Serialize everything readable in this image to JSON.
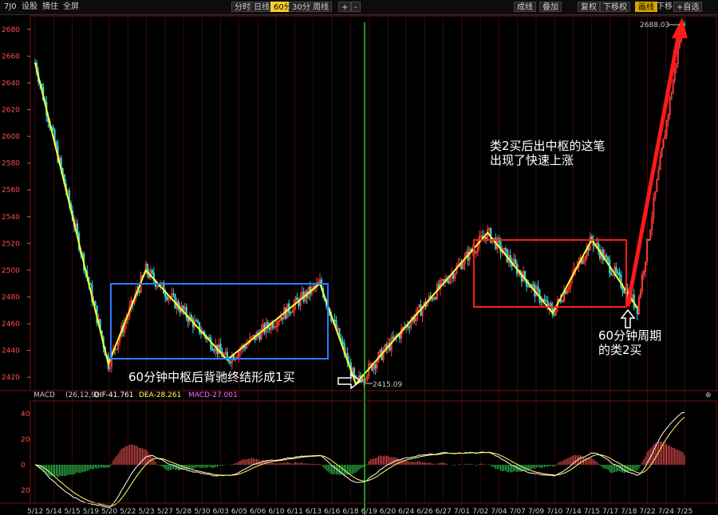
{
  "toolbar": {
    "left": {
      "code": "7J0",
      "item1": "设股",
      "item2": "摘住",
      "item3": "全屏"
    },
    "periods": {
      "p1": "分时",
      "p2": "日线",
      "p3": "60分",
      "p4": "30分",
      "p5": "周线",
      "plus": "+",
      "minus": "-"
    },
    "right": {
      "r1": "成线",
      "r2": "叠加",
      "r3": "复权",
      "r4": "下移权",
      "r5": "画线",
      "r6": "下移",
      "r7": "自选"
    }
  },
  "colors": {
    "background": "#000000",
    "up_candle": "#ff3b3b",
    "down_candle": "#33d6d6",
    "stroke_line": "#ffff33",
    "blue_box": "#2a7bff",
    "red_box": "#ff1a1a",
    "green_line": "#33ff33",
    "dif": "#ffffff",
    "dea": "#ffff66"
  },
  "chart_data": [
    {
      "type": "candlestick",
      "ylim": [
        2410,
        2690
      ],
      "y_ticks": [
        2420,
        2440,
        2460,
        2480,
        2500,
        2520,
        2540,
        2560,
        2580,
        2600,
        2620,
        2640,
        2660,
        2680
      ],
      "x_labels": [
        "5/12",
        "5/14",
        "5/15",
        "5/19",
        "5/20",
        "5/22",
        "5/23",
        "5/27",
        "5/28",
        "5/30",
        "6/03",
        "6/05",
        "6/06",
        "6/10",
        "6/11",
        "6/13",
        "6/16",
        "6/18",
        "6/19",
        "6/20",
        "6/24",
        "6/26",
        "6/27",
        "7/01",
        "7/02",
        "7/04",
        "7/07",
        "7/09",
        "7/10",
        "7/14",
        "7/15",
        "7/17",
        "7/18",
        "7/22",
        "7/24",
        "7/25"
      ],
      "max_label": "2688.03",
      "min_label": "2415.09",
      "stroke_points": [
        {
          "bar": 0,
          "price": 2655
        },
        {
          "bar": 45,
          "price": 2430
        },
        {
          "bar": 68,
          "price": 2500
        },
        {
          "bar": 118,
          "price": 2433
        },
        {
          "bar": 175,
          "price": 2490
        },
        {
          "bar": 197,
          "price": 2415
        },
        {
          "bar": 278,
          "price": 2528
        },
        {
          "bar": 318,
          "price": 2468
        },
        {
          "bar": 342,
          "price": 2523
        },
        {
          "bar": 370,
          "price": 2472
        }
      ],
      "rally": {
        "from": {
          "bar": 370,
          "price": 2472
        },
        "to": {
          "bar": 398,
          "price": 2688
        }
      },
      "annotations": [
        {
          "text_lines": [
            "类2买后出中枢的这笔",
            "出现了快速上涨"
          ]
        },
        {
          "text_lines": [
            "60分钟中枢后背驰终结形成1买"
          ]
        },
        {
          "text_lines": [
            "60分钟周期",
            "的类2买"
          ]
        }
      ]
    },
    {
      "type": "macd",
      "title": "MACD",
      "params": "(26,12,9)",
      "dif_label": "DIF-41.761",
      "dea_label": "DEA-28.261",
      "macd_label": "MACD-27.001",
      "ylim": [
        -30,
        50
      ],
      "y_ticks": [
        40,
        20,
        0,
        20
      ]
    }
  ]
}
